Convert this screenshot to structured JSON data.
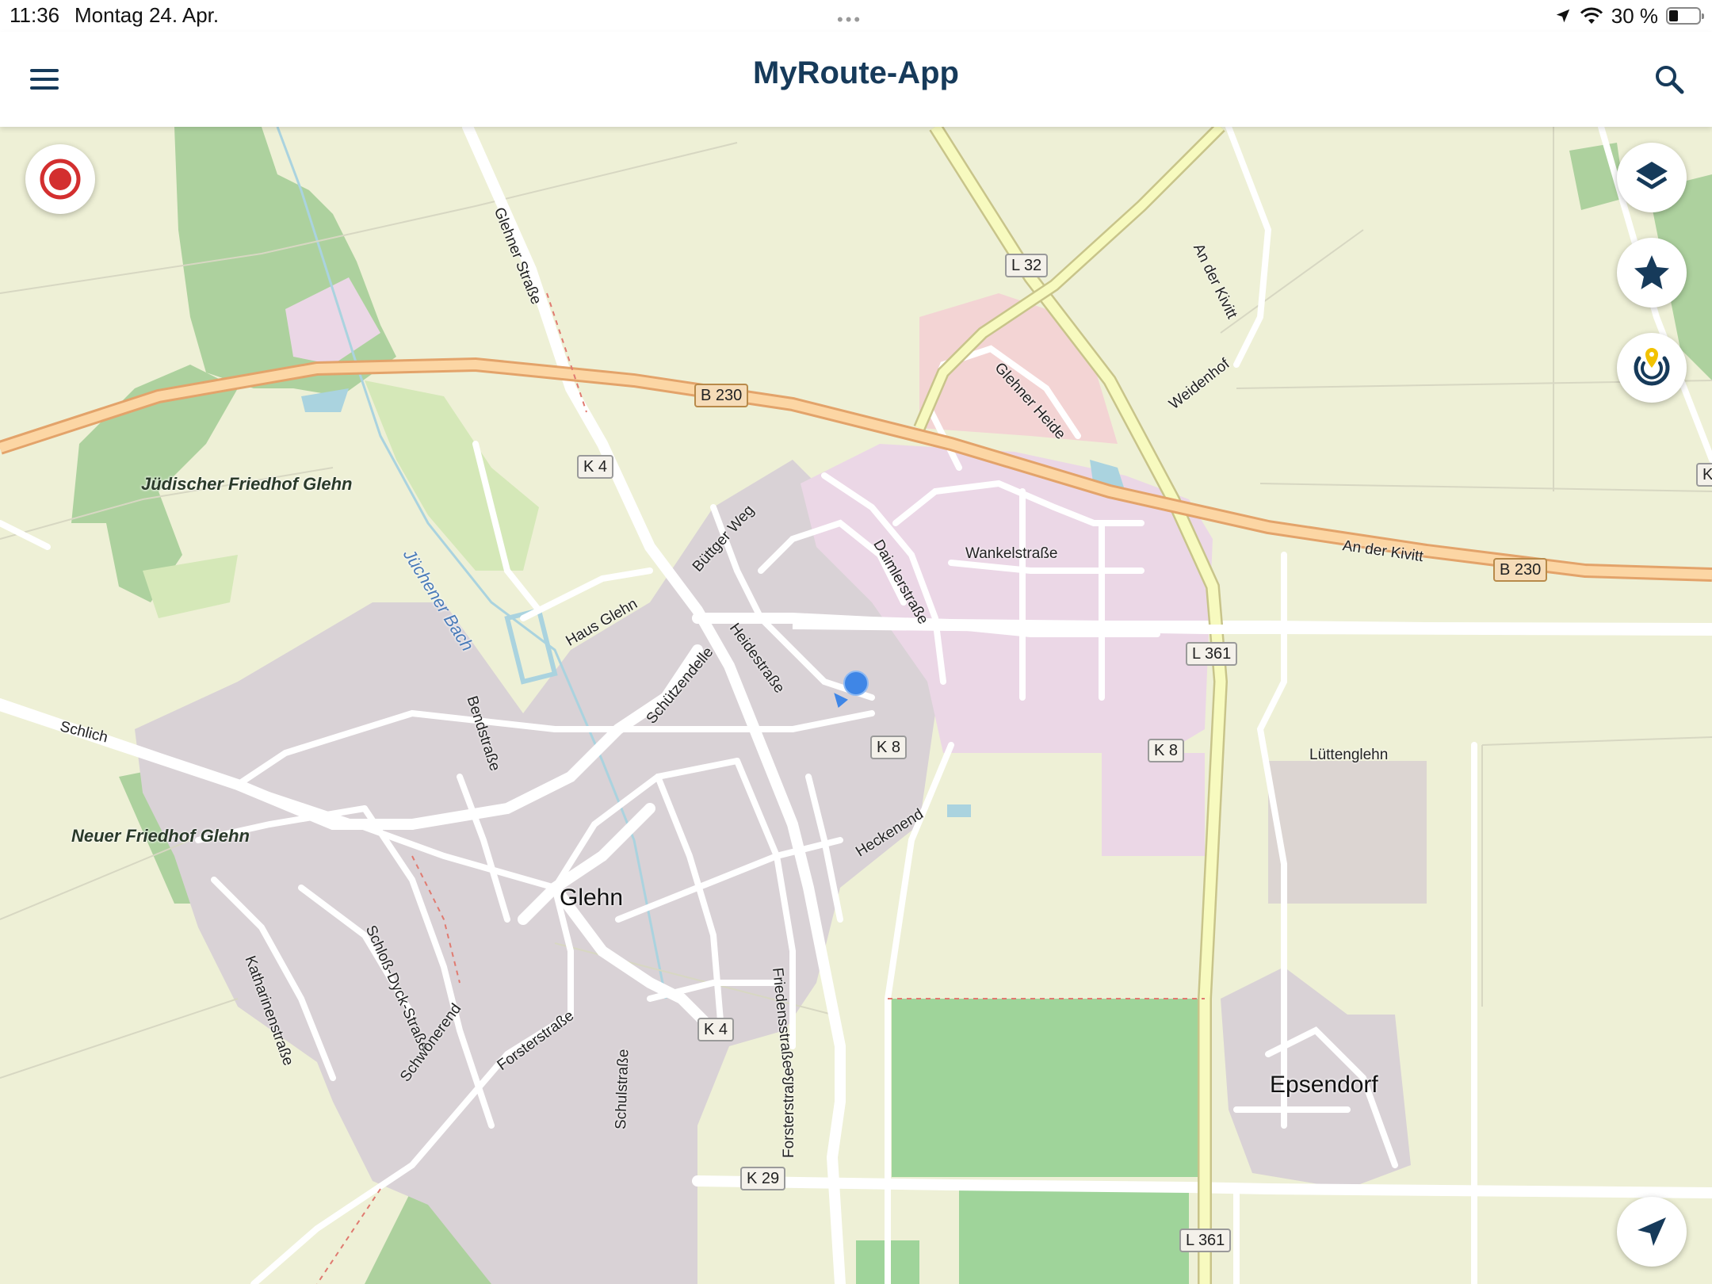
{
  "status_bar": {
    "time": "11:36",
    "date": "Montag 24. Apr.",
    "battery": "30 %",
    "battery_level": 0.3,
    "icons": [
      "location-arrow-icon",
      "wifi-icon",
      "battery-icon"
    ]
  },
  "header": {
    "title": "MyRoute-App",
    "menu_icon": "hamburger-menu-icon",
    "search_icon": "search-icon",
    "accent_color": "#163a5a"
  },
  "map": {
    "places": {
      "glehn": "Glehn",
      "epsendorf": "Epsendorf"
    },
    "pois": {
      "juedischer_friedhof": "Jüdischer Friedhof Glehn",
      "neuer_friedhof": "Neuer Friedhof Glehn"
    },
    "water": {
      "juechener_bach": "Jüchener Bach"
    },
    "streets": {
      "glehner_strasse": "Glehner Straße",
      "an_der_kivitt_n": "An der Kivitt",
      "glehner_heide": "Glehner Heide",
      "weidenhof": "Weidenhof",
      "an_der_kivitt_e": "An der Kivitt",
      "buettger_weg": "Büttger Weg",
      "daimlerstrasse": "Daimlerstraße",
      "wankelstrasse": "Wankelstraße",
      "heidestrasse": "Heidestraße",
      "haus_glehn": "Haus Glehn",
      "schuetzendelle": "Schützendelle",
      "schlich": "Schlich",
      "bendstrasse": "Bendstraße",
      "luettenglehn": "Lüttenglehn",
      "heckenend": "Heckenend",
      "friedensstrasse": "Friedensstraße",
      "katharinenstrasse": "Katharinenstraße",
      "schloss_dyck_strasse": "Schloß-Dyck-Straße",
      "schwonerend": "Schwonerend",
      "forsterstrasse_w": "Forsterstraße",
      "schulstrasse": "Schulstraße",
      "forsterstrasse_s": "Forsterstraße"
    },
    "road_shields": {
      "l32": "L 32",
      "b230_w": "B 230",
      "k4_n": "K 4",
      "b230_e": "B 230",
      "l361_n": "L 361",
      "k8_w": "K 8",
      "k8_e": "K 8",
      "k4_s": "K 4",
      "k29": "K 29",
      "l361_s": "L 361",
      "k_edge": "K"
    },
    "controls": [
      "record-icon",
      "layers-icon",
      "star-icon",
      "tracking-icon",
      "navigate-arrow-icon"
    ],
    "colors": {
      "record": "#d32f2f",
      "controls": "#163a5a",
      "tracking_pin": "#f2c200",
      "location": "#3f86e6"
    }
  }
}
